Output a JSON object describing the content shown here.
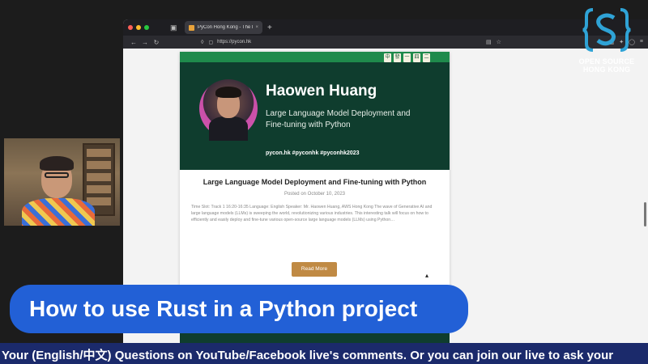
{
  "browser": {
    "tab_title": "PyCon Hong Kong - The leadi",
    "tab_close": "×",
    "new_tab": "+",
    "url": "https://pycon.hk"
  },
  "speaker_card": {
    "tiles": [
      "中",
      "發",
      "一",
      "四",
      "二"
    ],
    "speaker_name": "Haowen Huang",
    "talk_title": "Large Language Model Deployment and Fine-tuning with Python",
    "hashtags": "pycon.hk #pyconhk #pyconhk2023",
    "title": "Large Language Model Deployment and Fine-tuning with Python",
    "date": "Posted on October 10, 2023",
    "description": "Time Slot: Track 1 16:20-16:35 Language: English Speaker: Mr. Haowen Huang, AWS Hong Kong The wave of Generative AI and large language models (LLMs) is sweeping the world, revolutionizing various industries. This interesting talk will focus on how to efficiently and easily deploy and fine-tune various open-source large language models (LLMs) using Python…",
    "read_more": "Read More"
  },
  "logo": {
    "line1": "OPEN SOURCE",
    "line2": "HONG KONG"
  },
  "overlay": {
    "lower_third": "How to use Rust in a Python project",
    "ticker": "Your (English/中文) Questions on YouTube/Facebook live's comments. Or you can join our live to ask your"
  },
  "colors": {
    "banner": "#0f3d2e",
    "accent_green": "#1f8a4c",
    "button": "#c08a44",
    "lower_third": "#2260d6",
    "ticker": "#1b2a6b"
  }
}
